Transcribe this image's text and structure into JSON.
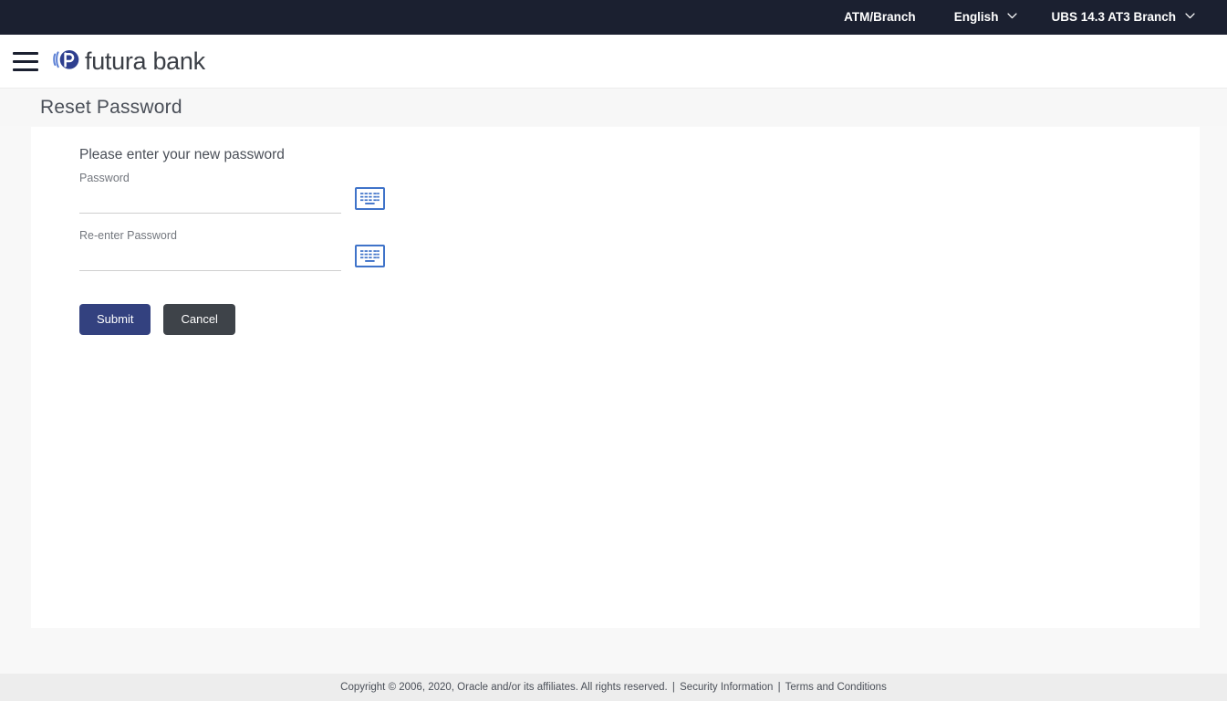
{
  "topbar": {
    "atm_branch": "ATM/Branch",
    "language": "English",
    "branch": "UBS 14.3 AT3 Branch",
    "chevron_icon": "chevron-down-icon",
    "background": "#1b2030",
    "text_color": "#ffffff"
  },
  "brand": {
    "menu_icon": "hamburger-menu-icon",
    "logo_icon": "futura-bank-logo-icon",
    "name": "futura bank",
    "logo_color": "#2e3f8f",
    "logo_accent": "#5b7fd4"
  },
  "page": {
    "title": "Reset Password"
  },
  "form": {
    "heading": "Please enter your new password",
    "password": {
      "label": "Password",
      "value": "",
      "placeholder": "",
      "keyboard_icon": "virtual-keyboard-icon"
    },
    "reenter_password": {
      "label": "Re-enter Password",
      "value": "",
      "placeholder": "",
      "keyboard_icon": "virtual-keyboard-icon"
    },
    "submit_label": "Submit",
    "cancel_label": "Cancel",
    "submit_color": "#33417f",
    "cancel_color": "#3e4349"
  },
  "footer": {
    "copyright": "Copyright © 2006, 2020, Oracle and/or its affiliates. All rights reserved.",
    "separator": "|",
    "security_information": "Security Information",
    "terms_and_conditions": "Terms and Conditions"
  }
}
